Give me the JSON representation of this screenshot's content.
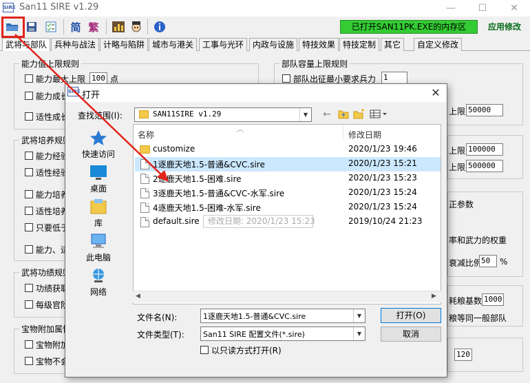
{
  "app": {
    "title": "San11 SIRE v1.29",
    "logo_text": "SIRE"
  },
  "window_controls": {
    "minimize": "—",
    "maximize": "☐",
    "close": "✕"
  },
  "toolbar": {
    "icons": [
      "open-folder-icon",
      "save-icon",
      "checklist-icon",
      "simplified-button",
      "traditional-button",
      "chart-icon",
      "character-icon",
      "info-icon"
    ],
    "simplified_label": "简",
    "traditional_label": "繁",
    "status_text": "已打开SAN11PK.EXE的内存区",
    "status_color": "#33cc33",
    "apply_label": "应用修改"
  },
  "tabs": [
    "武将与部队",
    "兵种与战法",
    "计略与陷阱",
    "城市与港关",
    "工事与光环",
    "内政与设施",
    "特技效果",
    "特技定制",
    "其它",
    "自定义修改"
  ],
  "main": {
    "group_ability": {
      "title": "能力值上限规则",
      "row1_label": "能力最大上限",
      "row1_value": "100",
      "row1_unit": "点",
      "row2_label": "能力成长",
      "row3_label": "适性成长"
    },
    "group_troop": {
      "title": "部队容量上限规则",
      "row1_label": "部队出征最小要求兵力",
      "row1_value": "1",
      "upper1_label": "上限",
      "upper1_value": "50000",
      "upper2_label": "上限",
      "upper2_value": "100000",
      "upper3_label": "上限",
      "upper3_value": "500000",
      "correction_label": "正参数",
      "weight_label": "率和武力的权重",
      "reduce_label": "衰减比例",
      "reduce_value": "50",
      "reduce_unit": "%",
      "grain_label": "耗粮基数",
      "grain_value": "1000",
      "grain2_label": "粮等同一般部队",
      "last_value": "120"
    },
    "group_training": {
      "title": "武将培养规则",
      "items": [
        "能力经验",
        "适性经验",
        "能力培养",
        "适性培养",
        "只要低于",
        "能力、适"
      ]
    },
    "group_merit": {
      "title": "武将功绩规则",
      "items": [
        "功绩获取",
        "每级官阶"
      ]
    },
    "group_treasure": {
      "title": "宝物附加属性",
      "items": [
        "宝物附加",
        "宝物不会"
      ]
    }
  },
  "dialog": {
    "title": "打开",
    "icon_text": "SIRE",
    "close": "✕",
    "lookin_label": "查找范围(I):",
    "lookin_value": "SAN11SIRE v1.29",
    "places": [
      "快速访问",
      "桌面",
      "库",
      "此电脑",
      "网络"
    ],
    "columns": {
      "name": "名称",
      "date": "修改日期"
    },
    "files": [
      {
        "name": "customize",
        "date": "2020/1/23 19:46",
        "kind": "folder"
      },
      {
        "name": "1逐鹿天地1.5-普通&CVC.sire",
        "date": "2020/1/23 15:21",
        "kind": "file"
      },
      {
        "name": "2逐鹿天地1.5-困难.sire",
        "date": "2020/1/23 15:23",
        "kind": "file"
      },
      {
        "name": "3逐鹿天地1.5-普通&CVC-水军.sire",
        "date": "2020/1/23 15:24",
        "kind": "file"
      },
      {
        "name": "4逐鹿天地1.5-困难-水军.sire",
        "date": "2020/1/23 15:24",
        "kind": "file"
      },
      {
        "name": "default.sire",
        "date": "2019/10/24 21:23",
        "kind": "file"
      }
    ],
    "selected_index": 1,
    "tooltip": "修改日期: 2020/1/23 15:23",
    "filename_label": "文件名(N):",
    "filename_value": "1逐鹿天地1.5-普通&CVC.sire",
    "filetype_label": "文件类型(T):",
    "filetype_value": "San11 SIRE 配置文件(*.sire)",
    "readonly_label": "以只读方式打开(R)",
    "open_label": "打开(O)",
    "cancel_label": "取消"
  },
  "annotation": {
    "color": "#e2231a"
  }
}
